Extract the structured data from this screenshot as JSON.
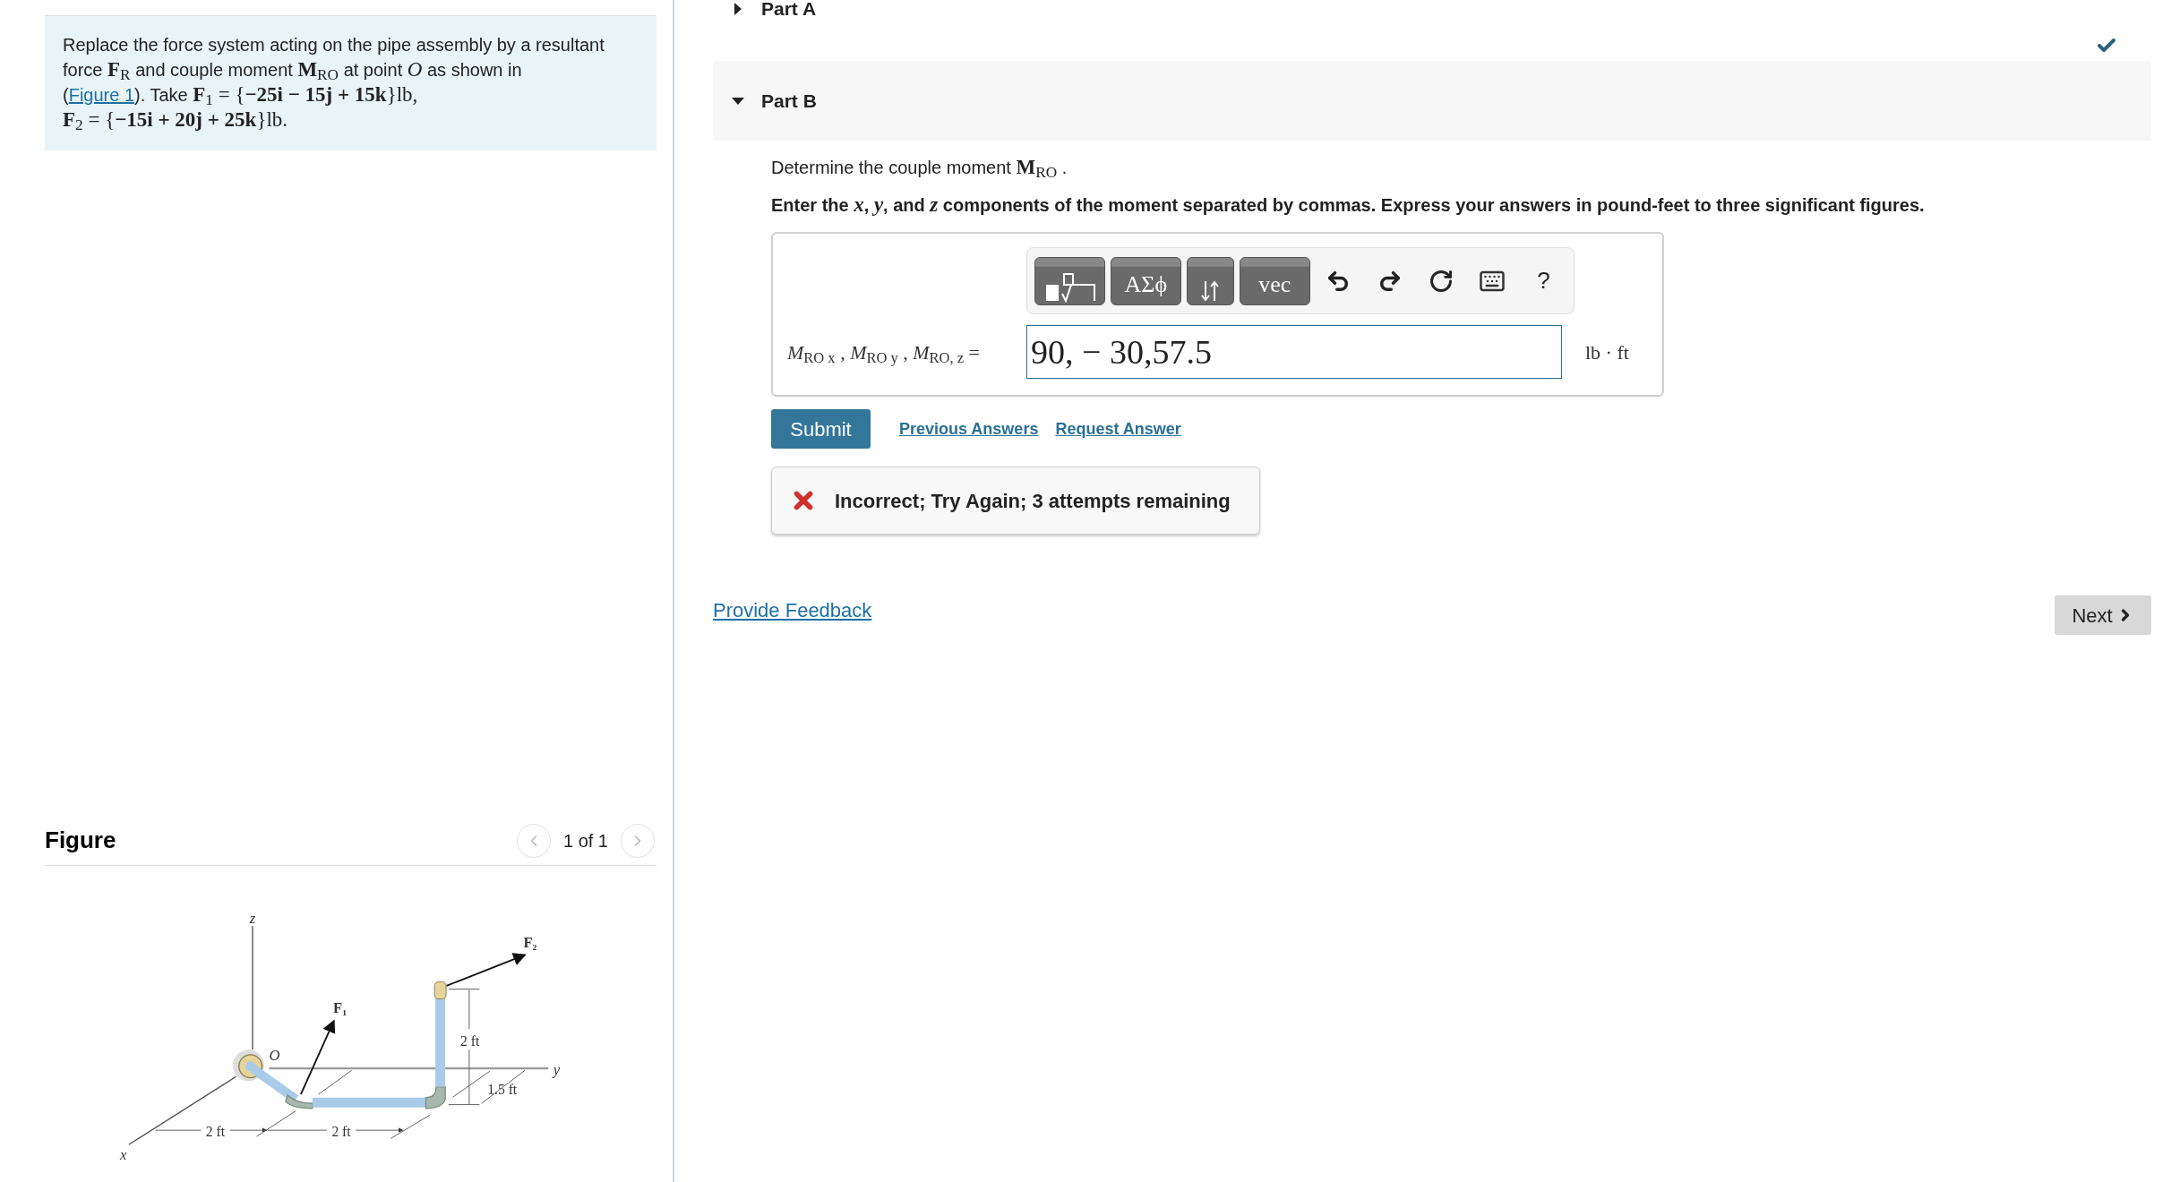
{
  "problem": [
    {
      "kind": "text",
      "text": "Replace the force system acting on the pipe assembly by a resultant force "
    },
    {
      "kind": "math",
      "text": "**F**$_{R}$"
    },
    {
      "kind": "text",
      "text": " and couple moment "
    },
    {
      "kind": "math",
      "text": "**M**$_{RO}$"
    },
    {
      "kind": "text",
      "text": " at point "
    },
    {
      "kind": "math",
      "text": "*O*"
    },
    {
      "kind": "text",
      "text": " as shown in"
    },
    {
      "kind": "text",
      "newline": true,
      "text": "("
    },
    {
      "kind": "link",
      "text": "Figure 1"
    },
    {
      "kind": "text",
      "text": "). Take "
    },
    {
      "kind": "math",
      "text": "**F**$_{1}$ = {**−25i − 15j + 15k**}lb,"
    },
    {
      "kind": "math",
      "newline": true,
      "text": "**F**$_{2}$ = {**−15i + 20j + 25k**}lb."
    }
  ],
  "figure": {
    "title": "Figure",
    "pager": "1 of 1",
    "labels": [
      {
        "kind": "axis",
        "text": "z"
      },
      {
        "kind": "axis",
        "text": "x"
      },
      {
        "kind": "axis",
        "text": "y"
      },
      {
        "kind": "point",
        "text": "O"
      },
      {
        "kind": "force",
        "text": "F₁"
      },
      {
        "kind": "force",
        "text": "F₂"
      },
      {
        "kind": "dimension",
        "text": "2 ft"
      },
      {
        "kind": "dimension",
        "text": "1.5 ft"
      },
      {
        "kind": "dimension",
        "text": "2 ft"
      },
      {
        "kind": "dimension",
        "text": "2 ft"
      }
    ]
  },
  "parts": [
    {
      "label": "Part A",
      "expanded": false,
      "completed": true
    },
    {
      "label": "Part B",
      "expanded": true,
      "completed": false,
      "prompt": [
        {
          "kind": "text",
          "text": "Determine the couple moment "
        },
        {
          "kind": "math",
          "text": "**M**$_{RO}$"
        },
        {
          "kind": "text",
          "text": " ."
        }
      ],
      "instruction": [
        {
          "kind": "text",
          "text": "Enter the "
        },
        {
          "kind": "math",
          "text": "*x*"
        },
        {
          "kind": "text",
          "text": ", "
        },
        {
          "kind": "math",
          "text": "*y*"
        },
        {
          "kind": "text",
          "text": ", and "
        },
        {
          "kind": "math",
          "text": "*z*"
        },
        {
          "kind": "text",
          "text": " components of the moment separated by commas. Express your answers in pound-feet to three significant figures."
        }
      ],
      "toolbar": [
        {
          "kind": "templates"
        },
        {
          "kind": "tile",
          "label": "ΑΣϕ"
        },
        {
          "kind": "arrows"
        },
        {
          "kind": "tile",
          "label": "vec"
        },
        {
          "kind": "undo"
        },
        {
          "kind": "redo"
        },
        {
          "kind": "reset"
        },
        {
          "kind": "keyboard"
        },
        {
          "kind": "help",
          "label": "?"
        }
      ],
      "answer": {
        "label": "*M*$_{RO x}$ , *M*$_{RO y}$ , *M*$_{RO, z}$ =",
        "value": "90, − 30,57.5",
        "units": "lb · ft"
      },
      "submit": "Submit",
      "links": [
        "Previous Answers",
        "Request Answer"
      ],
      "feedback": {
        "kind": "error",
        "message": "Incorrect; Try Again; 3 attempts remaining"
      }
    }
  ],
  "footer": {
    "feedback_link": "Provide Feedback",
    "next": "Next"
  }
}
